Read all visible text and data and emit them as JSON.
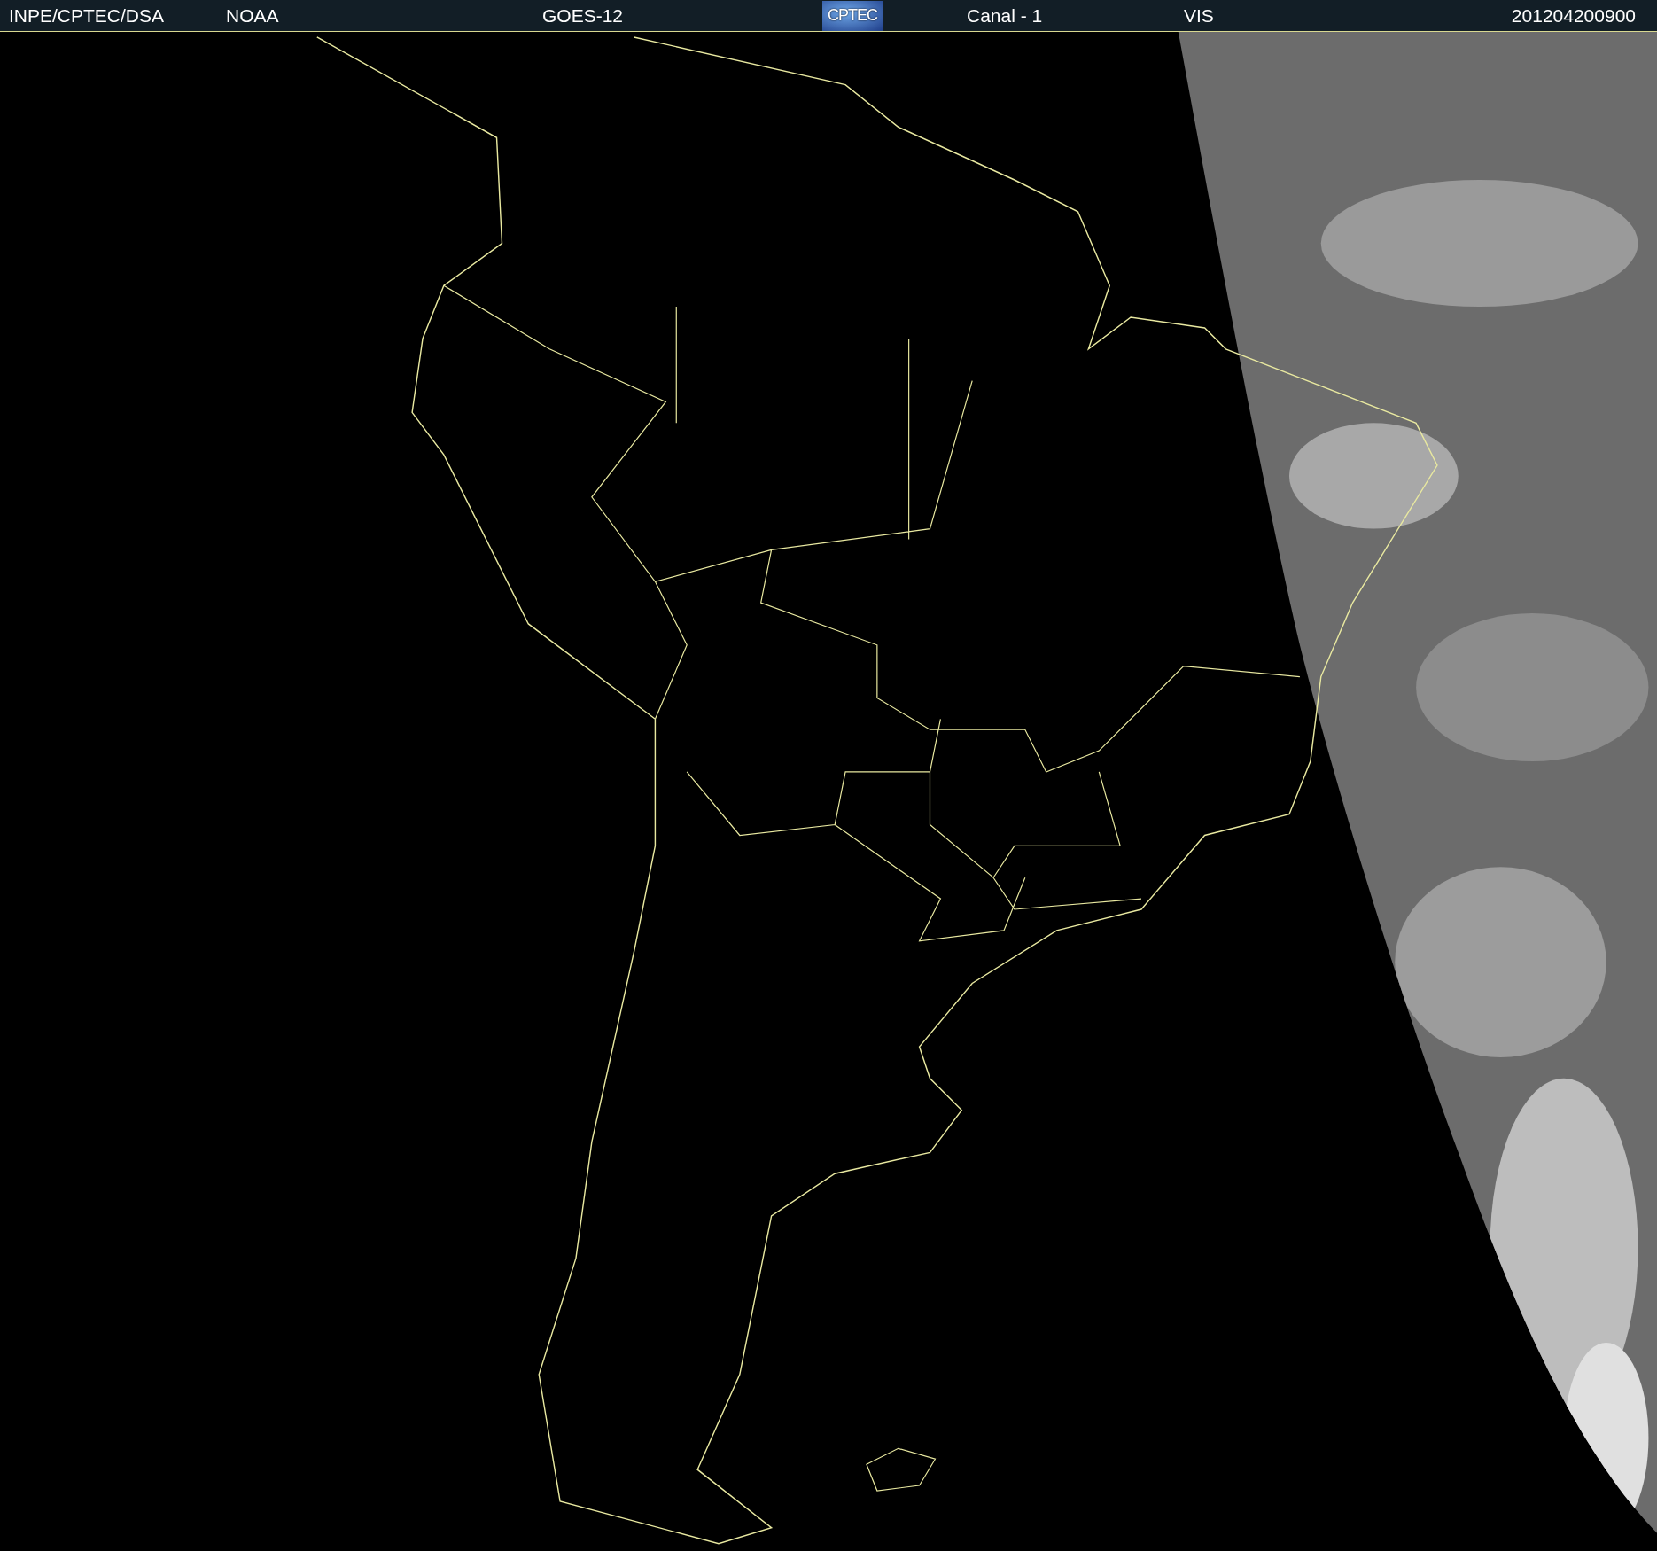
{
  "header": {
    "source": "INPE/CPTEC/DSA",
    "agency": "NOAA",
    "satellite": "GOES-12",
    "logo": "CPTEC",
    "channel": "Canal - 1",
    "band": "VIS",
    "timestamp": "201204200900"
  }
}
